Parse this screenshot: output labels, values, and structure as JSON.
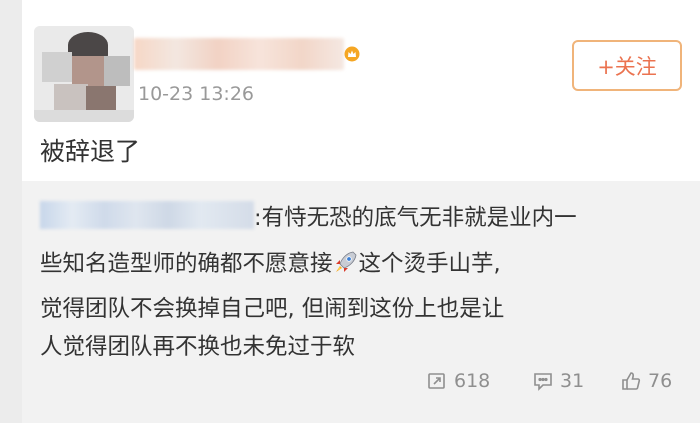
{
  "post": {
    "author_name": "",
    "timestamp": "10-23 13:26",
    "follow_label": "+关注",
    "text": "被辞退了"
  },
  "repost": {
    "mention": "",
    "line1": ":有恃无恐的底气无非就是业内一",
    "line2a": "些知名造型师的确都不愿意接",
    "line2b": "这个烫手山芋,",
    "line3": "觉得团队不会换掉自己吧, 但闹到这份上也是让",
    "line4": "人觉得团队再不换也未免过于软",
    "stats": {
      "reposts": "618",
      "comments": "31",
      "likes": "76"
    }
  },
  "icons": {
    "vip": "vip-crown-icon",
    "rocket": "rocket-icon",
    "repost": "repost-icon",
    "comment": "comment-icon",
    "like": "thumbs-up-icon"
  },
  "colors": {
    "follow_text": "#eb7350",
    "follow_border": "#f0b47a",
    "repost_bg": "#f2f2f2",
    "muted": "#999999"
  }
}
